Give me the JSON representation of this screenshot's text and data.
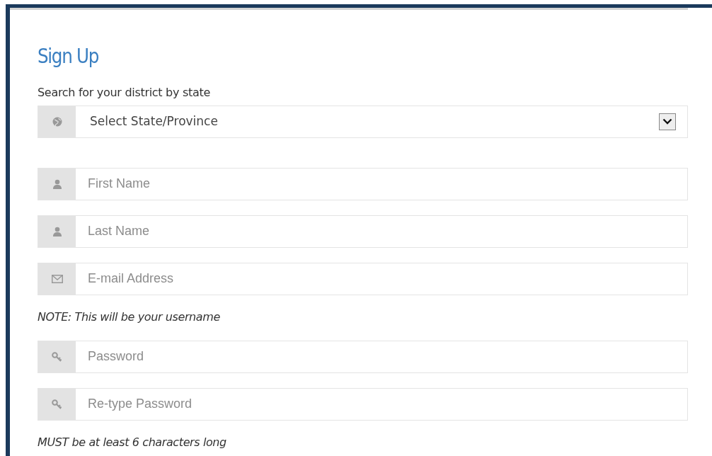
{
  "title": "Sign Up",
  "items": [
    {
      "kind": "label",
      "text": "Search for your district by state"
    },
    {
      "kind": "select",
      "value": "Select State/Province"
    },
    {
      "kind": "name",
      "placeholder": "First Name"
    },
    {
      "kind": "name",
      "placeholder": "Last Name"
    },
    {
      "kind": "email",
      "placeholder": "E-mail Address"
    },
    {
      "kind": "note",
      "text": "NOTE: This will be your username"
    },
    {
      "kind": "password",
      "placeholder": "Password"
    },
    {
      "kind": "password",
      "placeholder": "Re-type Password"
    },
    {
      "kind": "note",
      "text": "MUST be at least 6 characters long"
    }
  ]
}
